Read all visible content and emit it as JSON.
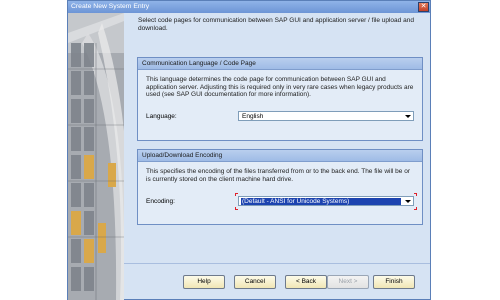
{
  "window": {
    "title": "Create New System Entry",
    "close_symbol": "✕"
  },
  "intro": "Select code pages for communication between SAP GUI and application server / file upload and download.",
  "language_group": {
    "title": "Communication Language / Code Page",
    "description": "This language determines the code page for communication between SAP GUI and application server. Adjusting this is required only in very rare cases when legacy products are used (see SAP GUI documentation for more information).",
    "field_label": "Language:",
    "value": "English"
  },
  "encoding_group": {
    "title": "Upload/Download Encoding",
    "description": "This specifies the encoding of the files transferred from or to the back end. The file will be or is currently stored on the client machine hard drive.",
    "field_label": "Encoding:",
    "value": "(Default - ANSI for Unicode Systems)"
  },
  "buttons": {
    "help": "Help",
    "cancel": "Cancel",
    "back": "< Back",
    "next": "Next >",
    "finish": "Finish"
  },
  "colors": {
    "selection": "#1c43b0",
    "focus_marker": "#e0202a",
    "panel": "#e3ecf7"
  }
}
